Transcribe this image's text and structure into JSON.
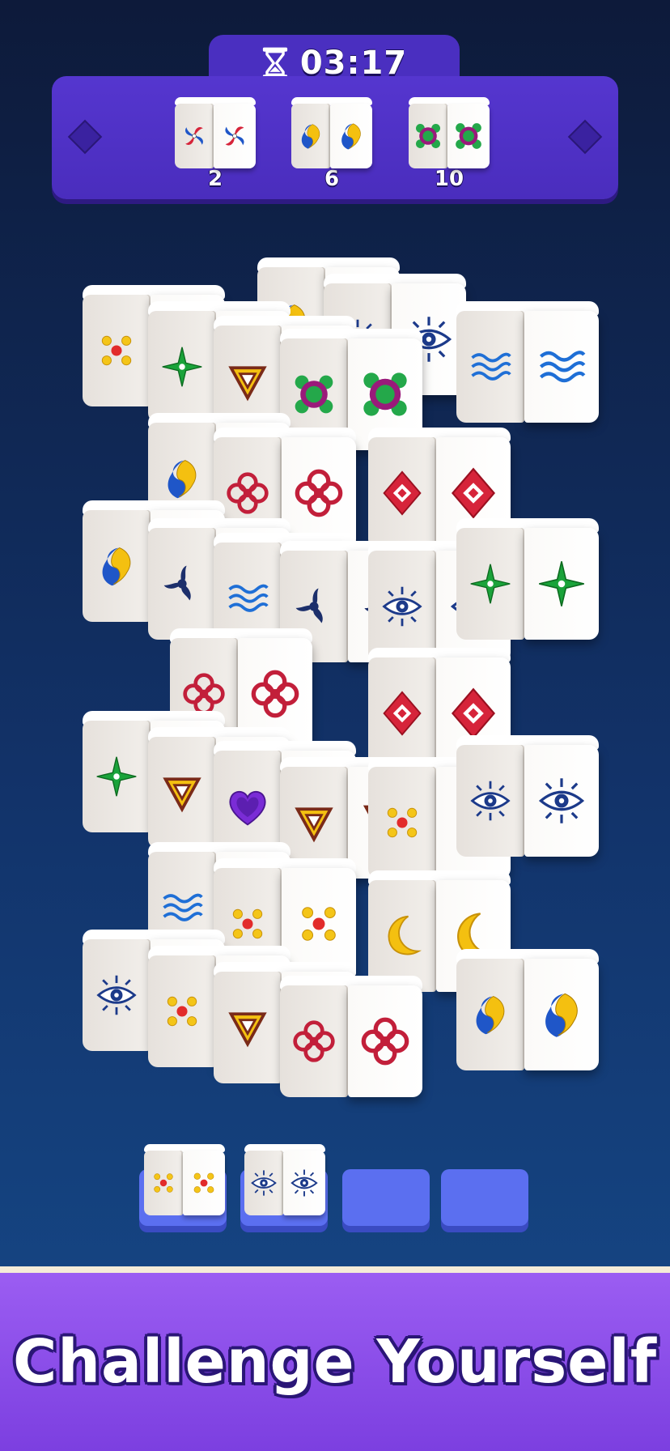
{
  "hud": {
    "timer_icon": "hourglass-icon",
    "timer": "03:17",
    "goals": [
      {
        "symbol": "pinwheel",
        "count": "2"
      },
      {
        "symbol": "yinyang",
        "count": "6"
      },
      {
        "symbol": "green-flower",
        "count": "10"
      }
    ]
  },
  "board": {
    "cubes": [
      {
        "symbol": "swirl-yinyang",
        "state": "blocked"
      },
      {
        "symbol": "eye",
        "state": "blocked"
      },
      {
        "symbol": "waves",
        "state": "free"
      },
      {
        "symbol": "dots-cross",
        "state": "free"
      },
      {
        "symbol": "green-star",
        "state": "free"
      },
      {
        "symbol": "triangle",
        "state": "free"
      },
      {
        "symbol": "green-flower",
        "state": "free"
      },
      {
        "symbol": "swirl-yinyang",
        "state": "blocked"
      },
      {
        "symbol": "red-knot",
        "state": "blocked"
      },
      {
        "symbol": "red-diamond",
        "state": "free"
      },
      {
        "symbol": "swirl-yinyang",
        "state": "free"
      },
      {
        "symbol": "triskelion",
        "state": "free"
      },
      {
        "symbol": "waves",
        "state": "free"
      },
      {
        "symbol": "triskelion",
        "state": "free"
      },
      {
        "symbol": "eye",
        "state": "free"
      },
      {
        "symbol": "green-star",
        "state": "free"
      },
      {
        "symbol": "red-knot",
        "state": "blocked"
      },
      {
        "symbol": "red-diamond",
        "state": "free"
      },
      {
        "symbol": "green-star",
        "state": "free"
      },
      {
        "symbol": "triangle",
        "state": "free"
      },
      {
        "symbol": "purple-heart",
        "state": "free"
      },
      {
        "symbol": "triangle",
        "state": "free"
      },
      {
        "symbol": "dots-cross",
        "state": "free"
      },
      {
        "symbol": "eye",
        "state": "free"
      },
      {
        "symbol": "waves",
        "state": "blocked"
      },
      {
        "symbol": "dots-cross",
        "state": "free"
      },
      {
        "symbol": "moon",
        "state": "free"
      },
      {
        "symbol": "eye",
        "state": "free"
      },
      {
        "symbol": "dots-cross",
        "state": "free"
      },
      {
        "symbol": "triangle",
        "state": "free"
      },
      {
        "symbol": "red-knot",
        "state": "free"
      },
      {
        "symbol": "swirl-yinyang",
        "state": "free"
      }
    ]
  },
  "tray": {
    "slots": [
      {
        "symbol": "dots-cross",
        "filled": true
      },
      {
        "symbol": "eye",
        "filled": true
      },
      {
        "symbol": "",
        "filled": false
      },
      {
        "symbol": "",
        "filled": false
      }
    ]
  },
  "banner": {
    "title": "Challenge Yourself"
  },
  "colors": {
    "panel": "#4a2fc0",
    "background_top": "#0d1a3a",
    "background_bottom": "#164a8a",
    "slot": "#5b6ff0",
    "banner": "#8a4de8"
  }
}
